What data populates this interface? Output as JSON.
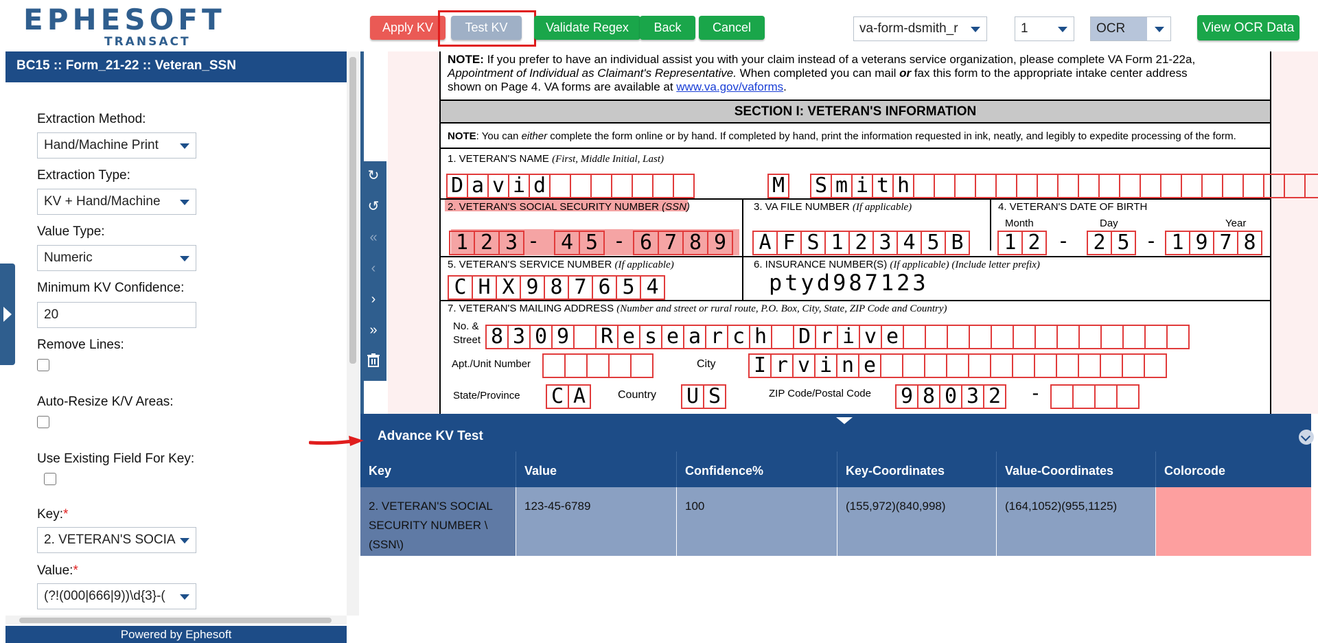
{
  "logo": {
    "main": "EPHESOFT",
    "sub": "TRANSACT"
  },
  "toolbar": {
    "apply_kv": "Apply KV",
    "test_kv": "Test KV",
    "validate_regex": "Validate Regex",
    "back": "Back",
    "cancel": "Cancel",
    "document_select": "va-form-dsmith_r",
    "page_select": "1",
    "ocr_select": "OCR",
    "view_ocr": "View OCR Data"
  },
  "sidebar": {
    "title": "BC15 :: Form_21-22 :: Veteran_SSN",
    "extraction_method_label": "Extraction Method:",
    "extraction_method_value": "Hand/Machine Print",
    "extraction_type_label": "Extraction Type:",
    "extraction_type_value": "KV + Hand/Machine",
    "value_type_label": "Value Type:",
    "value_type_value": "Numeric",
    "min_conf_label": "Minimum KV Confidence:",
    "min_conf_value": "20",
    "remove_lines_label": "Remove Lines:",
    "auto_resize_label": "Auto-Resize K/V Areas:",
    "use_existing_label": "Use Existing Field For Key:",
    "key_label": "Key:",
    "key_value": "2. VETERAN'S SOCIA",
    "value_label": "Value:",
    "value_value": "(?!(000|666|9))\\d{3}-(",
    "required_mark": "*",
    "powered": "Powered by Ephesoft"
  },
  "document": {
    "note_bold": "NOTE:",
    "note_line1": " If you prefer to have an individual assist you with your claim instead of a veterans service organization, please complete VA Form 21-22a,",
    "note_line2_italic": "Appointment of Individual as Claimant's Representative.",
    "note_line2": " When completed you can mail ",
    "note_line2_bold": "or",
    "note_line2_end": " fax this form to the appropriate intake center address",
    "note_line3": "shown on Page 4. VA forms are available at ",
    "note_link": "www.va.gov/vaforms",
    "note_line3_end": ".",
    "section_title": "SECTION I: VETERAN'S INFORMATION",
    "note2_bold": "NOTE",
    "note2_a": ": You can ",
    "note2_italic": "either",
    "note2_b": " complete the form online or by hand. If completed by hand, print the information requested in ink, neatly, and legibly to expedite processing of the form.",
    "f1_label": "1. VETERAN'S NAME ",
    "f1_italic": "(First, Middle Initial, Last)",
    "first_name": [
      "D",
      "a",
      "v",
      "i",
      "d",
      "",
      "",
      "",
      "",
      "",
      "",
      ""
    ],
    "middle": [
      "M"
    ],
    "last_name": [
      "S",
      "m",
      "i",
      "t",
      "h",
      "",
      "",
      "",
      "",
      "",
      "",
      "",
      "",
      "",
      "",
      "",
      "",
      "",
      "",
      "",
      "",
      "",
      "",
      "",
      "",
      "",
      "",
      ""
    ],
    "f2_label": "2. VETERAN'S SOCIAL SECURITY NUMBER ",
    "f2_italic": "(SSN)",
    "ssn": {
      "a": [
        "1",
        "2",
        "3"
      ],
      "dash": "-",
      "b": [
        "4",
        "5"
      ],
      "c": [
        "6",
        "7",
        "8",
        "9"
      ]
    },
    "f3_label": "3. VA FILE NUMBER ",
    "f3_italic": "(If applicable)",
    "va_file": [
      "A",
      "F",
      "S",
      "1",
      "2",
      "3",
      "4",
      "5",
      "B"
    ],
    "f4_label": "4. VETERAN'S DATE OF BIRTH",
    "month_label": "Month",
    "day_label": "Day",
    "year_label": "Year",
    "dob": {
      "month": [
        "1",
        "2"
      ],
      "day": [
        "2",
        "5"
      ],
      "year": [
        "1",
        "9",
        "7",
        "8"
      ]
    },
    "f5_label": "5. VETERAN'S SERVICE NUMBER ",
    "f5_italic": "(If applicable)",
    "service": [
      "C",
      "H",
      "X",
      "9",
      "8",
      "7",
      "6",
      "5",
      "4"
    ],
    "f6_label": "6. INSURANCE NUMBER(S) ",
    "f6_italic": "(If applicable) (Include letter prefix)",
    "insurance": "ptyd987123",
    "f7_label": "7. VETERAN'S MAILING ADDRESS ",
    "f7_italic": "(Number and street or rural route, P.O. Box, City, State, ZIP Code and Country)",
    "street_label_1": "No. &",
    "street_label_2": "Street",
    "street": [
      "8",
      "3",
      "0",
      "9",
      "",
      "R",
      "e",
      "s",
      "e",
      "a",
      "r",
      "c",
      "h",
      "",
      "D",
      "r",
      "i",
      "v",
      "e",
      "",
      "",
      "",
      "",
      "",
      "",
      "",
      "",
      "",
      "",
      "",
      "",
      ""
    ],
    "apt_label": "Apt./Unit Number",
    "apt": [
      "",
      "",
      "",
      "",
      ""
    ],
    "city_label": "City",
    "city": [
      "I",
      "r",
      "v",
      "i",
      "n",
      "e",
      "",
      "",
      "",
      "",
      "",
      "",
      "",
      "",
      "",
      "",
      "",
      "",
      ""
    ],
    "state_label": "State/Province",
    "state": [
      "C",
      "A"
    ],
    "country_label": "Country",
    "country": [
      "U",
      "S"
    ],
    "zip_label": "ZIP Code/Postal Code",
    "zip": [
      "9",
      "8",
      "0",
      "3",
      "2"
    ],
    "zip_dash": "-",
    "zip_ext": [
      "",
      "",
      "",
      ""
    ]
  },
  "kv": {
    "title": "Advance KV Test",
    "columns": [
      "Key",
      "Value",
      "Confidence%",
      "Key-Coordinates",
      "Value-Coordinates",
      "Colorcode"
    ],
    "row": {
      "key": "2. VETERAN'S SOCIAL SECURITY NUMBER \\ (SSN\\)",
      "value": "123-45-6789",
      "confidence": "100",
      "key_coords": "(155,972)(840,998)",
      "value_coords": "(164,1052)(955,1125)",
      "colorcode": "#fd9f9f"
    }
  },
  "colors": {
    "brand": "#1d4c87",
    "apply": "#ea5a55",
    "green": "#1aa64a"
  }
}
